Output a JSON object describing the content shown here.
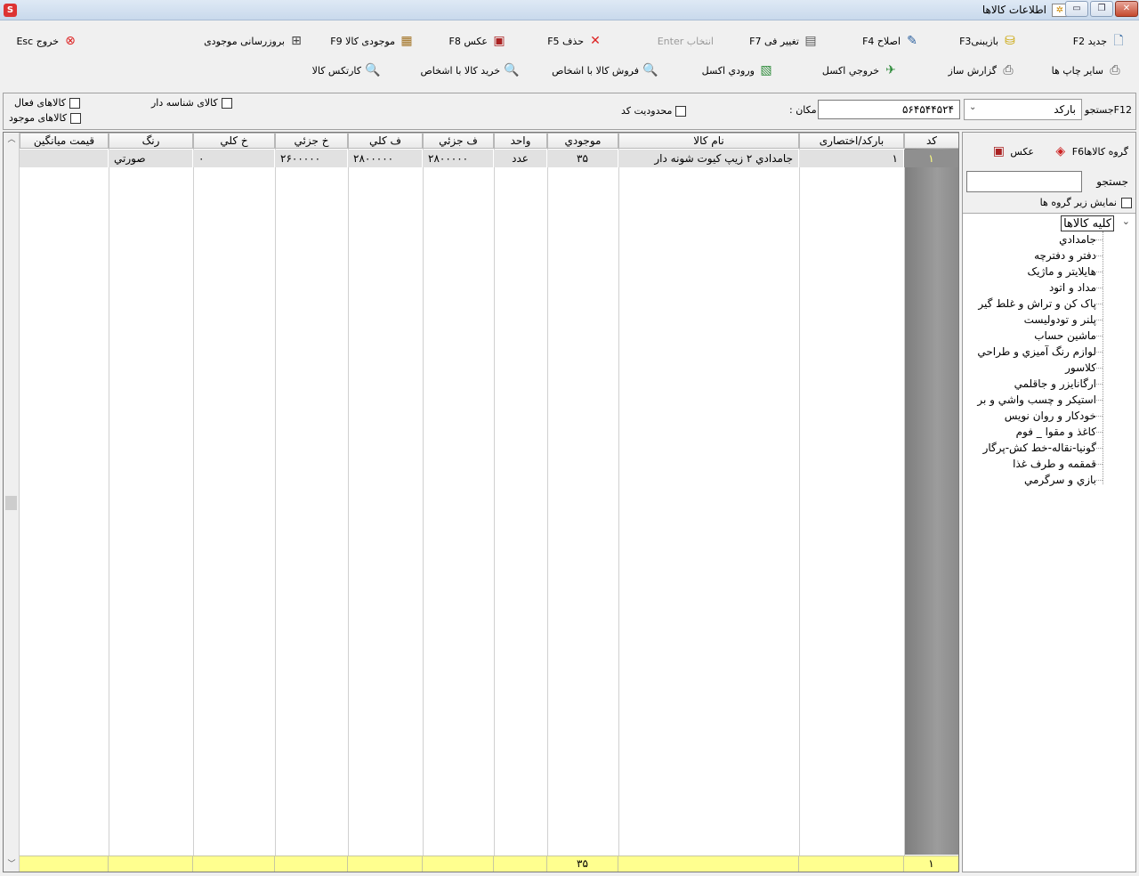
{
  "window": {
    "title": "اطلاعات کالاها"
  },
  "toolbar": {
    "new": "جدید F2",
    "restore": "بازیبنیF3",
    "edit": "اصلاح F4",
    "change_price": "تغییر فی F7",
    "select": "انتخاب Enter",
    "delete": "حذف F5",
    "photo": "عکس F8",
    "stock": "موجودی کالا F9",
    "update_stock": "بروزرسانی موجودی",
    "exit": "خروج Esc",
    "other_prints": "سایر چاپ ها",
    "report_builder": "گزارش ساز",
    "excel_out": "خروجي اکسل",
    "excel_in": "ورودي اکسل",
    "sell_to": "فروش کالا با اشخاص",
    "buy_from": "خرید کالا با اشخاص",
    "cardex": "کارتکس کالا"
  },
  "search": {
    "label": "F12جستجو",
    "field_type": "بارکد",
    "value": "۵۶۴۵۴۴۵۲۴",
    "place_label": "مکان :",
    "code_limit": "محدودیت کد",
    "has_serial": "کالای شناسه دار",
    "active": "کالاهای فعال",
    "in_stock": "کالاهای موجود"
  },
  "grid": {
    "columns": [
      "کد",
      "بارکد/اختصاری",
      "نام کالا",
      "موجودي",
      "واحد",
      "ف جزئي",
      "ف کلي",
      "خ جزئي",
      "خ کلي",
      "رنگ",
      "قيمت ميانگين"
    ],
    "rows": [
      {
        "code": "۱",
        "barcode": "۱",
        "name": "جامدادي ۲ زيپ کيوت شونه دار",
        "stock": "۳۵",
        "unit": "عدد",
        "sell_part": "۲۸۰۰۰۰۰",
        "sell_whole": "۲۸۰۰۰۰۰",
        "buy_part": "۲۶۰۰۰۰۰",
        "buy_whole": "۰",
        "color": "صورتي",
        "avg_price": ""
      }
    ],
    "footer": {
      "code": "۱",
      "stock": "۳۵"
    }
  },
  "side": {
    "groups_btn": "گروه کالاهاF6",
    "photo_btn": "عکس",
    "search_label": "جستجو",
    "show_sub": "نمایش زیر گروه ها",
    "tree_root": "کلیه کالاها",
    "tree_items": [
      "جامدادي",
      "دفتر و دفترچه",
      "هايلايتر و ماژيک",
      "مداد و اتود",
      "پاک کن و تراش و غلط گير",
      "پلنر و تودوليست",
      "ماشين حساب",
      "لوازم رنگ آميزي و طراحي",
      "کلاسور",
      "ارگانايزر و جاقلمي",
      "استيکر و چسب واشي و بر",
      "خودکار و روان نويس",
      "کاغذ و مقوا _ فوم",
      "گونيا-نقاله-خط کش-پرگار",
      "قمقمه و طرف غذا",
      "بازي و سرگرمي"
    ]
  },
  "colors": {
    "footer": "#ffff8f",
    "row": "#e1e1e1",
    "code_col": "#8a8a8a"
  }
}
